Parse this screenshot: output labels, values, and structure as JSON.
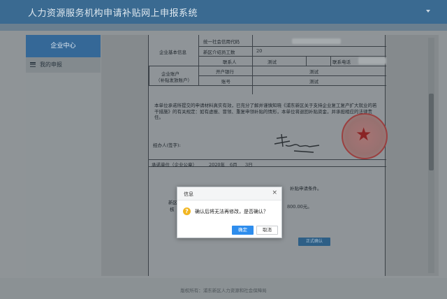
{
  "app": {
    "title": "人力资源服务机构申请补贴网上申报系统"
  },
  "sidebar": {
    "header": "企业中心",
    "items": [
      {
        "label": "我的申报"
      }
    ]
  },
  "form": {
    "section_basic": "企业基本信息",
    "credit_code_label": "统一社会信用代码",
    "district_count_label": "新区介绍员工数",
    "district_count_value": "20",
    "contact_label": "联系人",
    "contact_value": "测试",
    "phone_label": "联系电话",
    "account_label_1": "企业账户",
    "account_label_2": "（补贴发放账户）",
    "bank_label": "开户银行",
    "bank_value": "测试",
    "account_no_label": "账号",
    "account_no_value": "测试",
    "pledge": "本单位承诺所提交的申请材料真实有效，已充分了解并谨慎知晓《浦东新区关于支持企业复工复产扩大就业的若干措施》的有关规定：如有虚报、冒领、重复申领补贴的情形，本单位将退回补贴资金，并承担相应的法律责任。",
    "signer_label": "经办人(签字):",
    "seal_label": "承诺单位（企业公章）",
    "date_year": "2020年",
    "date_month": "6月",
    "date_day": "3日",
    "partial_text_1": "补贴申请条件。",
    "partial_amount": "800.00元。",
    "partial_label_1": "新区",
    "partial_label_2": "核",
    "submit_btn": "正式确认"
  },
  "dialog": {
    "title": "信息",
    "close": "×",
    "message": "确认后将无法再修改，是否确认？",
    "ok": "确定",
    "cancel": "取消",
    "icon": "question-icon",
    "icon_glyph": "?"
  },
  "footer": {
    "text": "版权所有：浦东新区人力资源和社会保障局"
  },
  "colors": {
    "header": "#3a6a91",
    "accent": "#2e8ded",
    "stamp": "#9c3c3c"
  }
}
